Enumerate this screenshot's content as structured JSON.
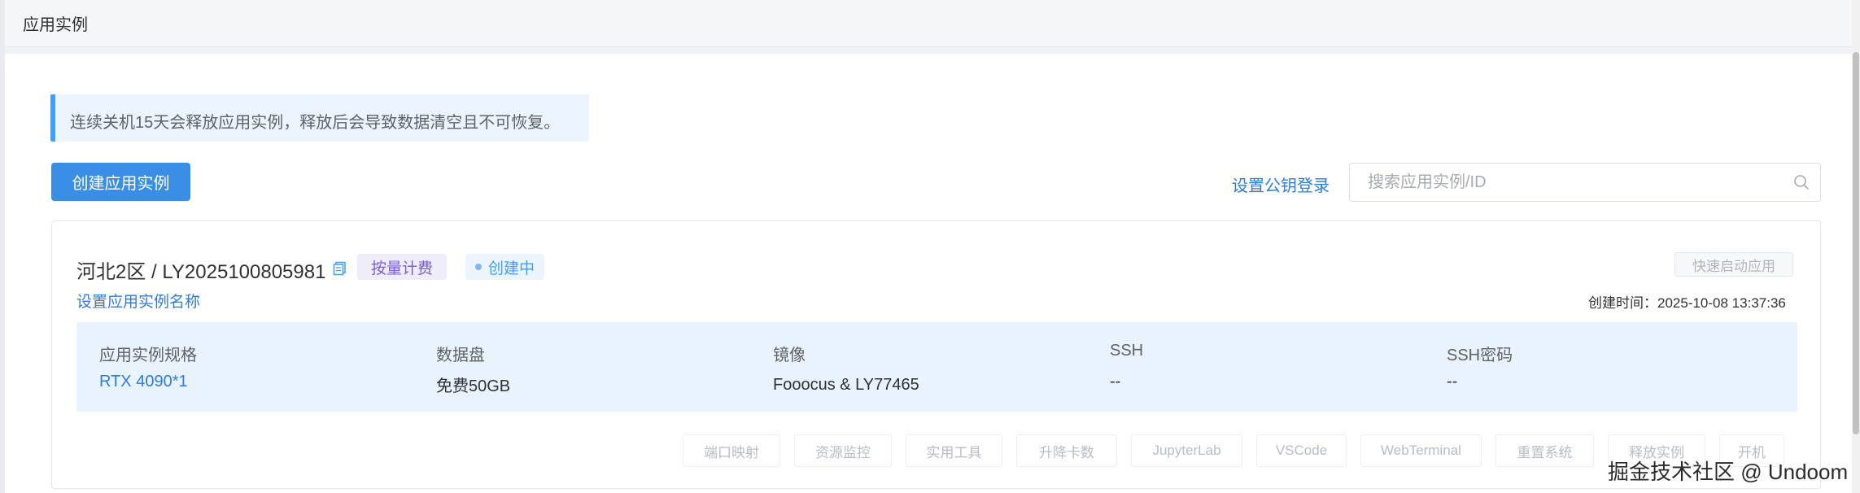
{
  "header": {
    "title": "应用实例"
  },
  "notice": {
    "text": "连续关机15天会释放应用实例，释放后会导致数据清空且不可恢复。"
  },
  "toolbar": {
    "create_label": "创建应用实例",
    "pubkey_label": "设置公钥登录",
    "search_placeholder": "搜索应用实例/ID"
  },
  "instance": {
    "title": "河北2区 / LY2025100805981",
    "billing_tag": "按量计费",
    "status_tag": "创建中",
    "rename_label": "设置应用实例名称",
    "quick_start_label": "快速启动应用",
    "created_time": "创建时间：2025-10-08 13:37:36",
    "specs": [
      {
        "label": "应用实例规格",
        "value": "RTX 4090*1"
      },
      {
        "label": "数据盘",
        "value": "免费50GB"
      },
      {
        "label": "镜像",
        "value": "Fooocus & LY77465"
      },
      {
        "label": "SSH",
        "value": "--"
      },
      {
        "label": "SSH密码",
        "value": "--"
      }
    ],
    "actions": [
      "端口映射",
      "资源监控",
      "实用工具",
      "升降卡数",
      "JupyterLab",
      "VSCode",
      "WebTerminal",
      "重置系统",
      "释放实例",
      "开机"
    ]
  },
  "watermark": "掘金技术社区 @ Undoom",
  "colors": {
    "primary": "#409eff",
    "link": "#2f7be0",
    "billing": "#7a5fd0"
  },
  "icons": {
    "copy": "copy-icon",
    "search": "search-icon"
  }
}
